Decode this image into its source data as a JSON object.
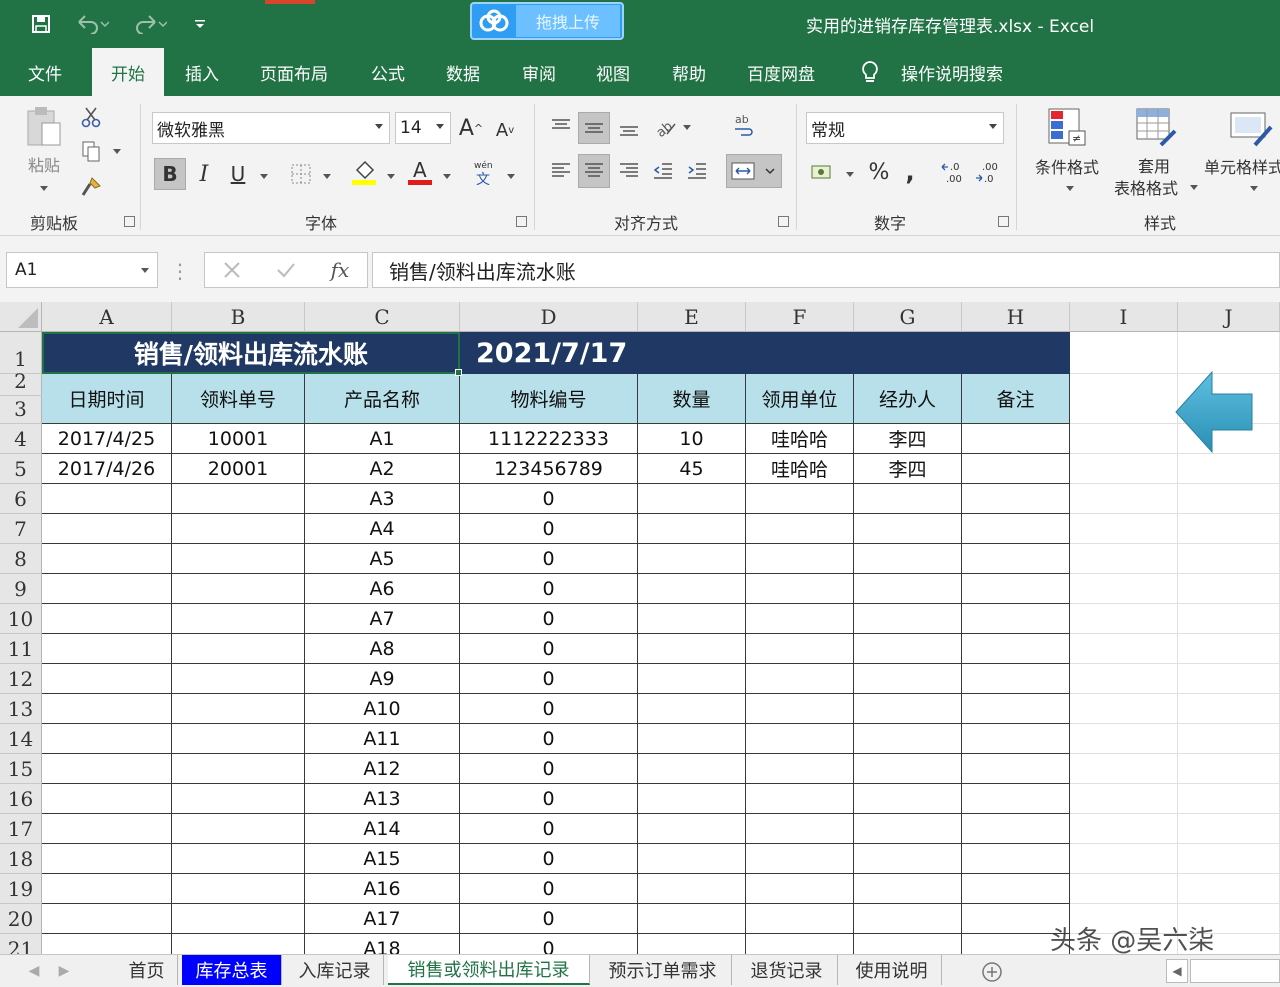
{
  "titlebar": {
    "title": "实用的进销存库存管理表.xlsx  -  Excel",
    "upload_label": "拖拽上传",
    "undo_icon": "undo-icon",
    "redo_icon": "redo-icon"
  },
  "menu": [
    {
      "label": "文件"
    },
    {
      "label": "开始"
    },
    {
      "label": "插入"
    },
    {
      "label": "页面布局"
    },
    {
      "label": "公式"
    },
    {
      "label": "数据"
    },
    {
      "label": "审阅"
    },
    {
      "label": "视图"
    },
    {
      "label": "帮助"
    },
    {
      "label": "百度网盘"
    },
    {
      "label": "操作说明搜索"
    }
  ],
  "ribbon": {
    "clipboard": {
      "paste": "粘贴",
      "label": "剪贴板"
    },
    "font": {
      "name": "微软雅黑",
      "size": "14",
      "label": "字体",
      "bold": "B",
      "italic": "I",
      "underline": "U"
    },
    "alignment": {
      "label": "对齐方式"
    },
    "number": {
      "format": "常规",
      "label": "数字",
      "percent": "%",
      "comma": ","
    },
    "styles": {
      "conditional": "条件格式",
      "table_1": "套用",
      "table_2": "表格格式",
      "cell": "单元格样式",
      "label": "样式"
    }
  },
  "formula_bar": {
    "name_box": "A1",
    "formula": "销售/领料出库流水账",
    "fx": "fx"
  },
  "columns": [
    "A",
    "B",
    "C",
    "D",
    "E",
    "F",
    "G",
    "H",
    "I",
    "J"
  ],
  "rows": [
    "1",
    "2",
    "3",
    "4",
    "5",
    "6",
    "7",
    "8",
    "9",
    "10",
    "11",
    "12",
    "13",
    "14",
    "15",
    "16",
    "17",
    "18",
    "19",
    "20",
    "21"
  ],
  "sheet": {
    "title": "销售/领料出库流水账",
    "date": "2021/7/17",
    "headers": [
      "日期时间",
      "领料单号",
      "产品名称",
      "物料编号",
      "数量",
      "领用单位",
      "经办人",
      "备注"
    ],
    "data_rows": [
      [
        "2017/4/25",
        "10001",
        "A1",
        "1112222333",
        "10",
        "哇哈哈",
        "李四",
        ""
      ],
      [
        "2017/4/26",
        "20001",
        "A2",
        "123456789",
        "45",
        "哇哈哈",
        "李四",
        ""
      ],
      [
        "",
        "",
        "A3",
        "0",
        "",
        "",
        "",
        ""
      ],
      [
        "",
        "",
        "A4",
        "0",
        "",
        "",
        "",
        ""
      ],
      [
        "",
        "",
        "A5",
        "0",
        "",
        "",
        "",
        ""
      ],
      [
        "",
        "",
        "A6",
        "0",
        "",
        "",
        "",
        ""
      ],
      [
        "",
        "",
        "A7",
        "0",
        "",
        "",
        "",
        ""
      ],
      [
        "",
        "",
        "A8",
        "0",
        "",
        "",
        "",
        ""
      ],
      [
        "",
        "",
        "A9",
        "0",
        "",
        "",
        "",
        ""
      ],
      [
        "",
        "",
        "A10",
        "0",
        "",
        "",
        "",
        ""
      ],
      [
        "",
        "",
        "A11",
        "0",
        "",
        "",
        "",
        ""
      ],
      [
        "",
        "",
        "A12",
        "0",
        "",
        "",
        "",
        ""
      ],
      [
        "",
        "",
        "A13",
        "0",
        "",
        "",
        "",
        ""
      ],
      [
        "",
        "",
        "A14",
        "0",
        "",
        "",
        "",
        ""
      ],
      [
        "",
        "",
        "A15",
        "0",
        "",
        "",
        "",
        ""
      ],
      [
        "",
        "",
        "A16",
        "0",
        "",
        "",
        "",
        ""
      ],
      [
        "",
        "",
        "A17",
        "0",
        "",
        "",
        "",
        ""
      ],
      [
        "",
        "",
        "A18",
        "0",
        "",
        "",
        "",
        ""
      ]
    ]
  },
  "sheet_tabs": [
    {
      "label": "首页",
      "style": "normal"
    },
    {
      "label": "库存总表",
      "style": "colored"
    },
    {
      "label": "入库记录",
      "style": "normal"
    },
    {
      "label": "销售或领料出库记录",
      "style": "active"
    },
    {
      "label": "预示订单需求",
      "style": "normal"
    },
    {
      "label": "退货记录",
      "style": "normal"
    },
    {
      "label": "使用说明",
      "style": "normal"
    }
  ],
  "watermark": "头条 @吴六柒",
  "colors": {
    "excel_green": "#217346",
    "title_fill": "#1f3864",
    "header_fill": "#b8e0ea",
    "arrow": "#3ba6c8"
  }
}
